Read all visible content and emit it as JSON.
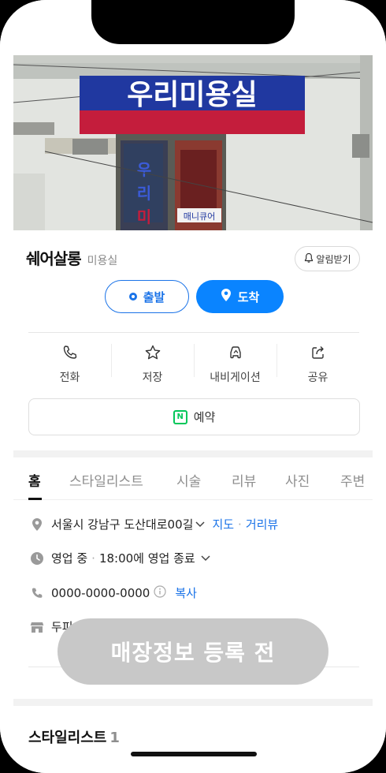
{
  "photo": {
    "sign_text": "우리미용실",
    "door_text_vertical": "우리미",
    "door_small_sign": "매니큐어"
  },
  "place": {
    "name": "쉐어살롱",
    "category": "미용실",
    "alarm_label": "알림받기"
  },
  "route": {
    "depart_label": "출발",
    "arrive_label": "도착"
  },
  "actions": [
    {
      "label": "전화",
      "icon": "phone-icon"
    },
    {
      "label": "저장",
      "icon": "star-icon"
    },
    {
      "label": "내비게이션",
      "icon": "navigation-icon"
    },
    {
      "label": "공유",
      "icon": "share-icon"
    }
  ],
  "reserve": {
    "label": "예약",
    "badge": "N"
  },
  "tabs": [
    "홈",
    "스타일리스트",
    "시술",
    "리뷰",
    "사진",
    "주변"
  ],
  "info": {
    "address": "서울시 강남구 도산대로00길",
    "map_link": "지도",
    "roadview_link": "거리뷰",
    "hours_status": "영업 중",
    "hours_detail": "18:00에 영업 종료",
    "phone": "0000-0000-0000",
    "copy_label": "복사",
    "extra_partial": "두피"
  },
  "floating_notice": "매장정보 등록 전",
  "stylist_section": {
    "title": "스타일리스트",
    "count": "1"
  },
  "colors": {
    "accent": "#0a84ff",
    "link": "#1a73e8",
    "naver_green": "#03c75a"
  }
}
